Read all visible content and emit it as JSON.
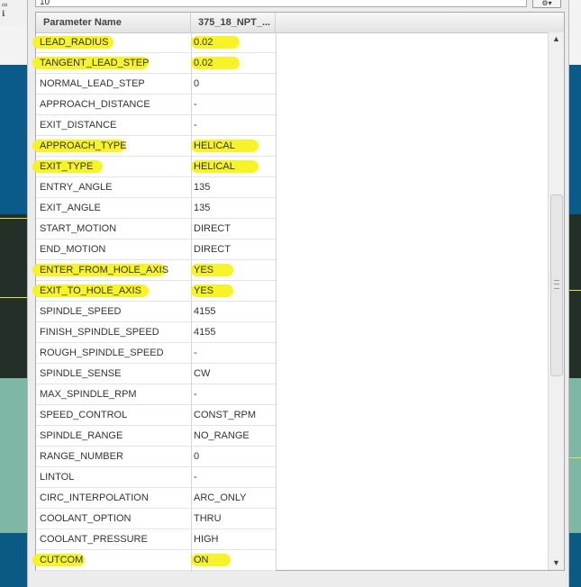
{
  "search": {
    "value": "10"
  },
  "background": {
    "left_tool_glyph": "⌂\nT"
  },
  "table": {
    "columns": [
      "Parameter Name",
      "375_18_NPT_..."
    ],
    "rows": [
      {
        "name": "LEAD_RADIUS",
        "value": "0.02",
        "highlight": true
      },
      {
        "name": "TANGENT_LEAD_STEP",
        "value": "0.02",
        "highlight": true
      },
      {
        "name": "NORMAL_LEAD_STEP",
        "value": "0",
        "highlight": false
      },
      {
        "name": "APPROACH_DISTANCE",
        "value": "-",
        "highlight": false
      },
      {
        "name": "EXIT_DISTANCE",
        "value": "-",
        "highlight": false
      },
      {
        "name": "APPROACH_TYPE",
        "value": "HELICAL",
        "highlight": true
      },
      {
        "name": "EXIT_TYPE",
        "value": "HELICAL",
        "highlight": true
      },
      {
        "name": "ENTRY_ANGLE",
        "value": "135",
        "highlight": false
      },
      {
        "name": "EXIT_ANGLE",
        "value": "135",
        "highlight": false
      },
      {
        "name": "START_MOTION",
        "value": "DIRECT",
        "highlight": false
      },
      {
        "name": "END_MOTION",
        "value": "DIRECT",
        "highlight": false
      },
      {
        "name": "ENTER_FROM_HOLE_AXIS",
        "value": "YES",
        "highlight": true
      },
      {
        "name": "EXIT_TO_HOLE_AXIS",
        "value": "YES",
        "highlight": true
      },
      {
        "name": "SPINDLE_SPEED",
        "value": "4155",
        "highlight": false
      },
      {
        "name": "FINISH_SPINDLE_SPEED",
        "value": "4155",
        "highlight": false
      },
      {
        "name": "ROUGH_SPINDLE_SPEED",
        "value": "-",
        "highlight": false
      },
      {
        "name": "SPINDLE_SENSE",
        "value": "CW",
        "highlight": false
      },
      {
        "name": "MAX_SPINDLE_RPM",
        "value": "-",
        "highlight": false
      },
      {
        "name": "SPEED_CONTROL",
        "value": "CONST_RPM",
        "highlight": false
      },
      {
        "name": "SPINDLE_RANGE",
        "value": "NO_RANGE",
        "highlight": false
      },
      {
        "name": "RANGE_NUMBER",
        "value": "0",
        "highlight": false
      },
      {
        "name": "LINTOL",
        "value": "-",
        "highlight": false
      },
      {
        "name": "CIRC_INTERPOLATION",
        "value": "ARC_ONLY",
        "highlight": false
      },
      {
        "name": "COOLANT_OPTION",
        "value": "THRU",
        "highlight": false
      },
      {
        "name": "COOLANT_PRESSURE",
        "value": "HIGH",
        "highlight": false
      },
      {
        "name": "CUTCOM",
        "value": "ON",
        "highlight": true
      }
    ]
  },
  "colors": {
    "highlight": "#f6f21e"
  },
  "icons": {
    "scroll_up": "▲",
    "scroll_down": "▼",
    "filter": "filter-icon"
  },
  "scroll": {
    "position_fraction": 0.45
  }
}
